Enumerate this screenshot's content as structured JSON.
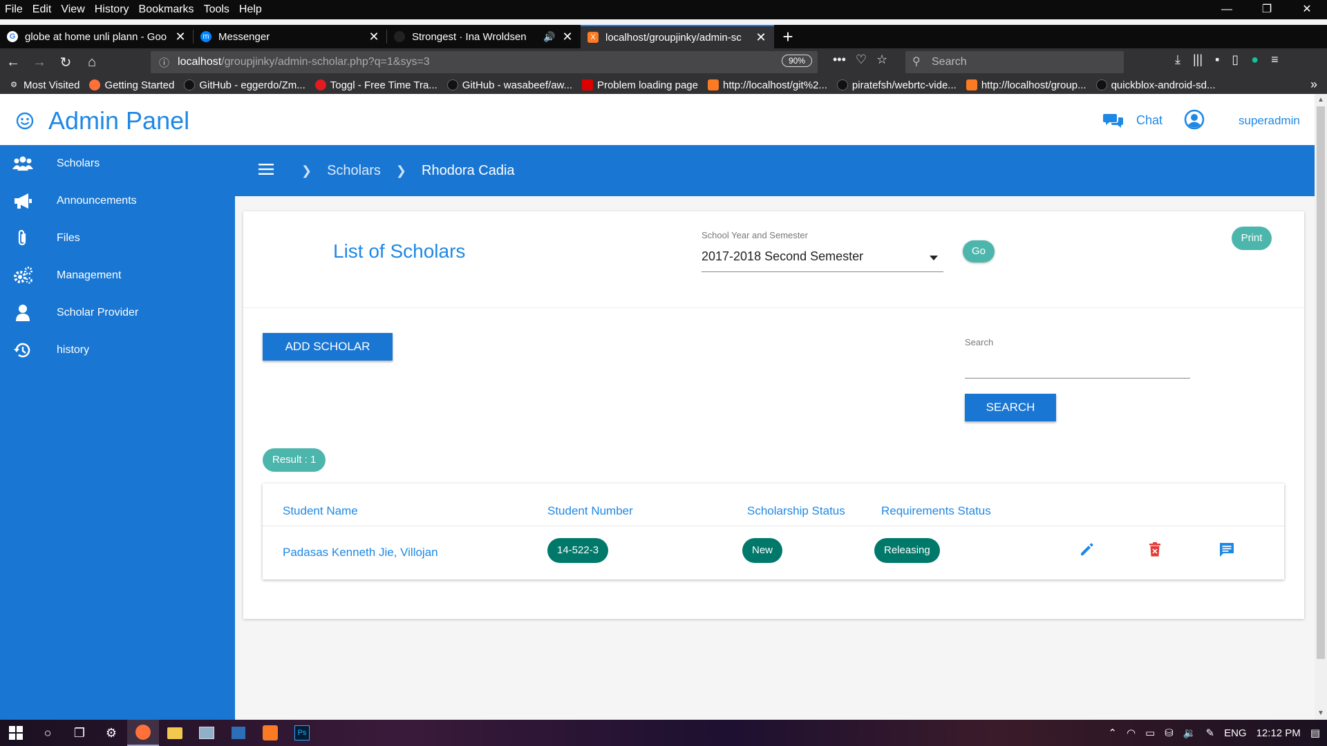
{
  "browser": {
    "menu": [
      "File",
      "Edit",
      "View",
      "History",
      "Bookmarks",
      "Tools",
      "Help"
    ],
    "window_controls": [
      "—",
      "❐",
      "✕"
    ],
    "tabs": [
      {
        "label": "globe at home unli plann - Goo",
        "favicon": "G",
        "color": "#ffffff",
        "active": false
      },
      {
        "label": "Messenger",
        "favicon": "m",
        "color": "#0084ff",
        "active": false
      },
      {
        "label": "Strongest · Ina Wroldsen",
        "favicon": "",
        "color": "#222222",
        "active": false
      },
      {
        "label": "localhost/groupjinky/admin-sc",
        "favicon": "X",
        "color": "#fb7a24",
        "active": true
      }
    ],
    "url_host": "localhost",
    "url_path": "/groupjinky/admin-scholar.php?q=1&sys=3",
    "zoom": "90%",
    "search_placeholder": "Search",
    "bookmarks": [
      {
        "label": "Most Visited",
        "icon": "gear-icon"
      },
      {
        "label": "Getting Started",
        "icon": "firefox-icon"
      },
      {
        "label": "GitHub - eggerdo/Zm...",
        "icon": "github-icon"
      },
      {
        "label": "Toggl - Free Time Tra...",
        "icon": "toggl-icon"
      },
      {
        "label": "GitHub - wasabeef/aw...",
        "icon": "github-icon"
      },
      {
        "label": "Problem loading page",
        "icon": "huawei-icon"
      },
      {
        "label": "http://localhost/git%2...",
        "icon": "xampp-icon"
      },
      {
        "label": "piratefsh/webrtc-vide...",
        "icon": "github-icon"
      },
      {
        "label": "http://localhost/group...",
        "icon": "xampp-icon"
      },
      {
        "label": "quickblox-android-sd...",
        "icon": "github-icon"
      }
    ]
  },
  "header": {
    "brand": "Admin Panel",
    "chat": "Chat",
    "user": "superadmin"
  },
  "sidebar": {
    "items": [
      {
        "label": "Scholars",
        "icon": "users-icon"
      },
      {
        "label": "Announcements",
        "icon": "megaphone-icon"
      },
      {
        "label": "Files",
        "icon": "paperclip-icon"
      },
      {
        "label": "Management",
        "icon": "gears-icon"
      },
      {
        "label": "Scholar Provider",
        "icon": "user-icon"
      },
      {
        "label": "history",
        "icon": "history-icon"
      }
    ]
  },
  "breadcrumb": {
    "items": [
      "Scholars",
      "Rhodora Cadia"
    ]
  },
  "main": {
    "title": "List of Scholars",
    "sy_label": "School Year and Semester",
    "sy_value": "2017-2018 Second Semester",
    "go": "Go",
    "print": "Print",
    "add": "ADD SCHOLAR",
    "search_label": "Search",
    "search_value": "",
    "search_button": "SEARCH",
    "result": "Result : 1",
    "columns": [
      "Student Name",
      "Student Number",
      "Scholarship Status",
      "Requirements Status"
    ],
    "rows": [
      {
        "name": "Padasas Kenneth Jie, Villojan",
        "number": "14-522-3",
        "scholarship": "New",
        "requirements": "Releasing"
      }
    ]
  },
  "taskbar": {
    "lang": "ENG",
    "time": "12:12 PM"
  },
  "colors": {
    "primary": "#1976d2",
    "accent_text": "#1e88e5",
    "teal": "#4db6ac",
    "dark_teal": "#00796b",
    "delete": "#e53935"
  }
}
